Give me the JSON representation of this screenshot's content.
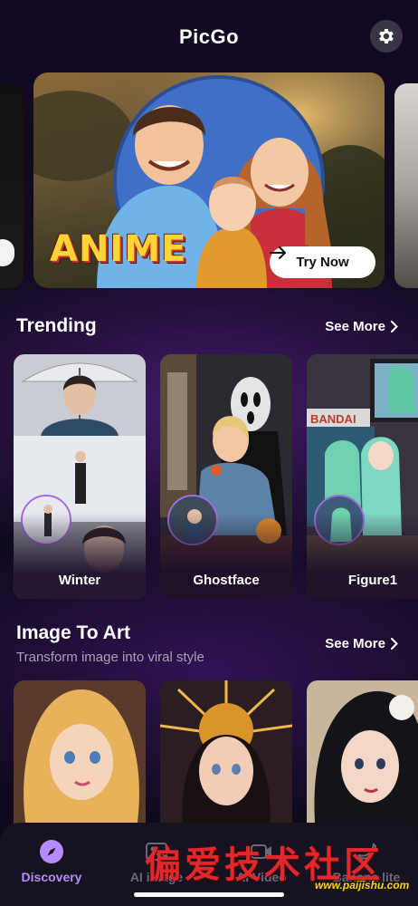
{
  "app": {
    "title": "PicGo"
  },
  "icons": {
    "settings": "gear-icon",
    "try_now_arrow": "arrow-right-icon",
    "see_more_chevron": "chevron-right-icon",
    "discovery": "compass-icon",
    "ai_image": "image-icon",
    "ai_video": "video-icon",
    "banana_lite": "banana-icon"
  },
  "banner": {
    "tag": "ANIME",
    "cta_label": "Try Now"
  },
  "trending": {
    "title": "Trending",
    "see_more": "See More",
    "cards": [
      {
        "label": "Winter"
      },
      {
        "label": "Ghostface"
      },
      {
        "label": "Figure1"
      }
    ]
  },
  "image_to_art": {
    "title": "Image To Art",
    "subtitle": "Transform image into viral style",
    "see_more": "See More"
  },
  "nav": {
    "items": [
      {
        "label": "Discovery",
        "active": true
      },
      {
        "label": "AI image",
        "active": false
      },
      {
        "label": "AI Video",
        "active": false
      },
      {
        "label": "Banana lite",
        "active": false
      }
    ]
  },
  "watermark": {
    "chinese": "偏爱技术社区",
    "url": "www.paijishu.com"
  },
  "colors": {
    "accent": "#b58cff",
    "background": "#0c0818",
    "nav_bg": "#16121f",
    "banner_tag": "#ffd437",
    "watermark_red": "#e3262a",
    "watermark_yellow": "#ffd400"
  }
}
